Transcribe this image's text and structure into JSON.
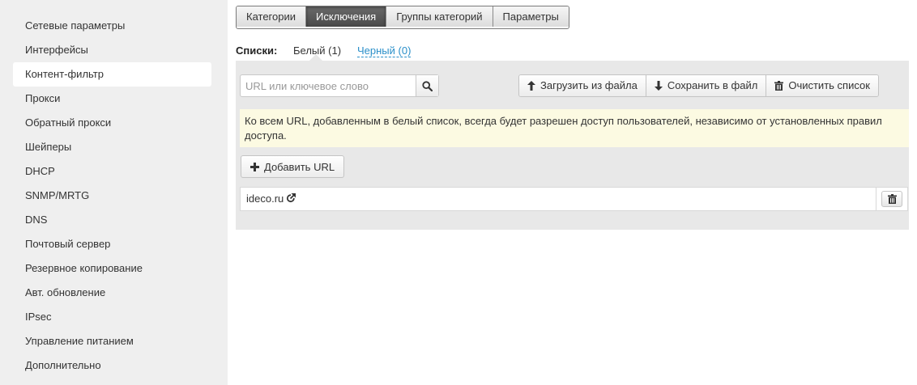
{
  "sidebar": {
    "items": [
      {
        "label": "Сетевые параметры"
      },
      {
        "label": "Интерфейсы"
      },
      {
        "label": "Контент-фильтр",
        "active": true
      },
      {
        "label": "Прокси"
      },
      {
        "label": "Обратный прокси"
      },
      {
        "label": "Шейперы"
      },
      {
        "label": "DHCP"
      },
      {
        "label": "SNMP/MRTG"
      },
      {
        "label": "DNS"
      },
      {
        "label": "Почтовый сервер"
      },
      {
        "label": "Резервное копирование"
      },
      {
        "label": "Авт. обновление"
      },
      {
        "label": "IPsec"
      },
      {
        "label": "Управление питанием"
      },
      {
        "label": "Дополнительно"
      }
    ]
  },
  "tabs": [
    {
      "label": "Категории"
    },
    {
      "label": "Исключения",
      "active": true
    },
    {
      "label": "Группы категорий"
    },
    {
      "label": "Параметры"
    }
  ],
  "lists": {
    "label": "Списки:",
    "white": "Белый (1)",
    "black": "Черный (0)"
  },
  "search": {
    "placeholder": "URL или ключевое слово",
    "value": "",
    "icon": "search-icon"
  },
  "toolbar": {
    "upload": "Загрузить из файла",
    "save": "Сохранить в файл",
    "clear": "Очистить список"
  },
  "notice": "Ко всем URL, добавленным в белый список, всегда будет разрешен доступ пользователей, независимо от установленных правил доступа.",
  "add_button": "Добавить URL",
  "rows": [
    {
      "url": "ideco.ru"
    }
  ],
  "colors": {
    "sidebar_bg": "#efefef",
    "panel_bg": "#e8e8e8",
    "notice_bg": "#fcfae2",
    "link": "#2a8fc9",
    "active_tab": "#4a4a4a"
  }
}
